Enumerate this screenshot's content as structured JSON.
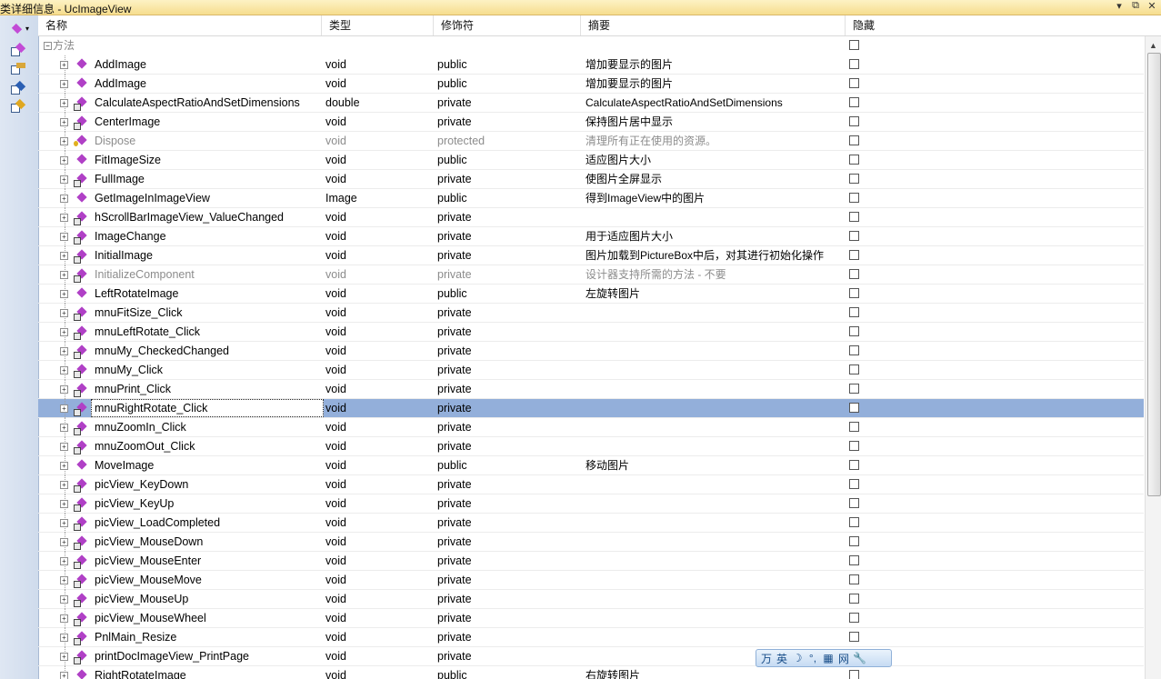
{
  "window": {
    "title": "类详细信息 - UcImageView",
    "buttons": [
      "▾",
      "⧉",
      "✕"
    ]
  },
  "columns": {
    "name": "名称",
    "type": "类型",
    "modifier": "修饰符",
    "summary": "摘要",
    "hidden": "隐藏"
  },
  "group": {
    "label": "方法"
  },
  "rows": [
    {
      "name": "AddImage",
      "type": "void",
      "modifier": "public",
      "summary": "增加要显示的图片"
    },
    {
      "name": "AddImage",
      "type": "void",
      "modifier": "public",
      "summary": "增加要显示的图片"
    },
    {
      "name": "CalculateAspectRatioAndSetDimensions",
      "type": "double",
      "modifier": "private",
      "summary": "CalculateAspectRatioAndSetDimensions"
    },
    {
      "name": "CenterImage",
      "type": "void",
      "modifier": "private",
      "summary": "保持图片居中显示"
    },
    {
      "name": "Dispose",
      "type": "void",
      "modifier": "protected",
      "summary": "清理所有正在使用的资源。"
    },
    {
      "name": "FitImageSize",
      "type": "void",
      "modifier": "public",
      "summary": "适应图片大小"
    },
    {
      "name": "FullImage",
      "type": "void",
      "modifier": "private",
      "summary": "使图片全屏显示"
    },
    {
      "name": "GetImageInImageView",
      "type": "Image",
      "modifier": "public",
      "summary": "得到ImageView中的图片"
    },
    {
      "name": "hScrollBarImageView_ValueChanged",
      "type": "void",
      "modifier": "private",
      "summary": ""
    },
    {
      "name": "ImageChange",
      "type": "void",
      "modifier": "private",
      "summary": "用于适应图片大小"
    },
    {
      "name": "InitialImage",
      "type": "void",
      "modifier": "private",
      "summary": "图片加载到PictureBox中后，对其进行初始化操作"
    },
    {
      "name": "InitializeComponent",
      "type": "void",
      "modifier": "private",
      "summary": "设计器支持所需的方法 - 不要"
    },
    {
      "name": "LeftRotateImage",
      "type": "void",
      "modifier": "public",
      "summary": "左旋转图片"
    },
    {
      "name": "mnuFitSize_Click",
      "type": "void",
      "modifier": "private",
      "summary": ""
    },
    {
      "name": "mnuLeftRotate_Click",
      "type": "void",
      "modifier": "private",
      "summary": ""
    },
    {
      "name": "mnuMy_CheckedChanged",
      "type": "void",
      "modifier": "private",
      "summary": ""
    },
    {
      "name": "mnuMy_Click",
      "type": "void",
      "modifier": "private",
      "summary": ""
    },
    {
      "name": "mnuPrint_Click",
      "type": "void",
      "modifier": "private",
      "summary": ""
    },
    {
      "name": "mnuRightRotate_Click",
      "type": "void",
      "modifier": "private",
      "summary": ""
    },
    {
      "name": "mnuZoomIn_Click",
      "type": "void",
      "modifier": "private",
      "summary": ""
    },
    {
      "name": "mnuZoomOut_Click",
      "type": "void",
      "modifier": "private",
      "summary": ""
    },
    {
      "name": "MoveImage",
      "type": "void",
      "modifier": "public",
      "summary": "移动图片"
    },
    {
      "name": "picView_KeyDown",
      "type": "void",
      "modifier": "private",
      "summary": ""
    },
    {
      "name": "picView_KeyUp",
      "type": "void",
      "modifier": "private",
      "summary": ""
    },
    {
      "name": "picView_LoadCompleted",
      "type": "void",
      "modifier": "private",
      "summary": ""
    },
    {
      "name": "picView_MouseDown",
      "type": "void",
      "modifier": "private",
      "summary": ""
    },
    {
      "name": "picView_MouseEnter",
      "type": "void",
      "modifier": "private",
      "summary": ""
    },
    {
      "name": "picView_MouseMove",
      "type": "void",
      "modifier": "private",
      "summary": ""
    },
    {
      "name": "picView_MouseUp",
      "type": "void",
      "modifier": "private",
      "summary": ""
    },
    {
      "name": "picView_MouseWheel",
      "type": "void",
      "modifier": "private",
      "summary": ""
    },
    {
      "name": "PnlMain_Resize",
      "type": "void",
      "modifier": "private",
      "summary": ""
    },
    {
      "name": "printDocImageView_PrintPage",
      "type": "void",
      "modifier": "private",
      "summary": ""
    },
    {
      "name": "RightRotateImage",
      "type": "void",
      "modifier": "public",
      "summary": "右旋转图片"
    }
  ],
  "ime_bar": {
    "items": [
      "万",
      "英",
      "☽",
      "°,",
      "▦",
      "网",
      "🔧"
    ]
  }
}
